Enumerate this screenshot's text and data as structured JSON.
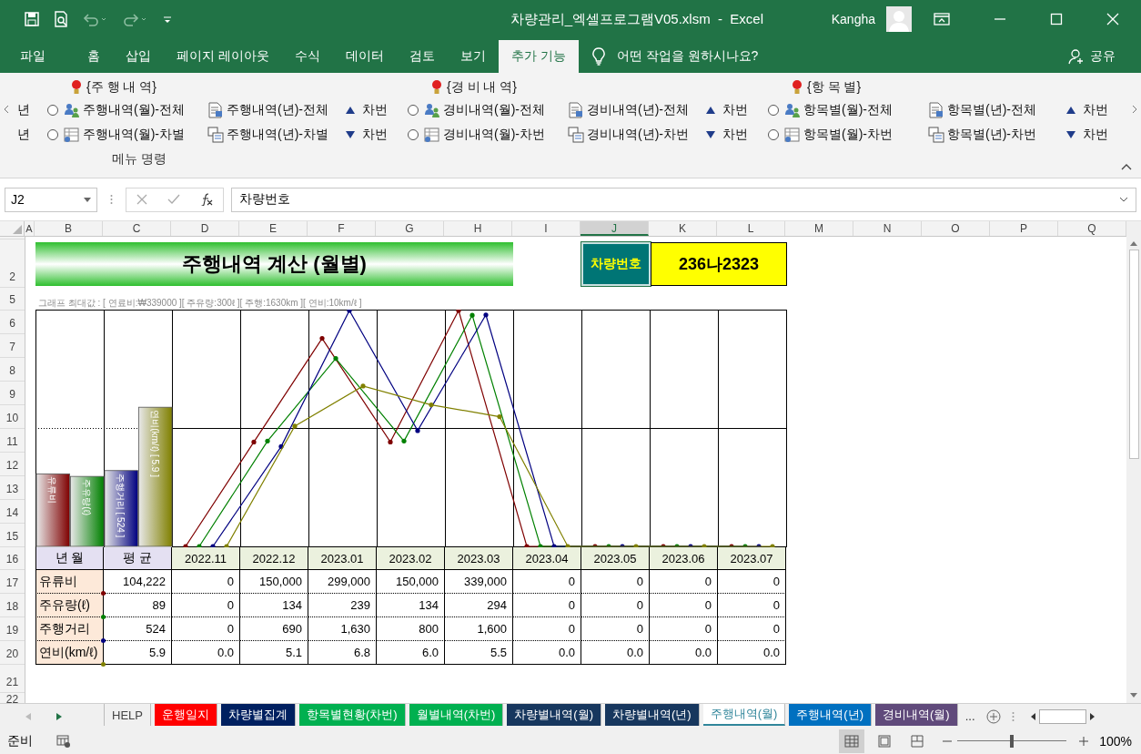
{
  "window": {
    "title": "차량관리_엑셀프로그램V05.xlsm  -  Excel",
    "user": "Kangha"
  },
  "ribbon_tabs": [
    {
      "label": "파일",
      "selected": false
    },
    {
      "label": "홈",
      "selected": false
    },
    {
      "label": "삽입",
      "selected": false
    },
    {
      "label": "페이지 레이아웃",
      "selected": false
    },
    {
      "label": "수식",
      "selected": false
    },
    {
      "label": "데이터",
      "selected": false
    },
    {
      "label": "검토",
      "selected": false
    },
    {
      "label": "보기",
      "selected": false
    },
    {
      "label": "추가 기능",
      "selected": true
    }
  ],
  "tell_me": "어떤 작업을 원하시나요?",
  "share": "공유",
  "ribbon": {
    "cut_labels": [
      "년",
      "년"
    ],
    "sections": [
      {
        "header": "{주 행 내 역}",
        "rows": [
          {
            "checked": false,
            "commands": [
              "주행내역(월)-전체",
              "주행내역(년)-전체"
            ],
            "sort": {
              "kind": "up",
              "label": "차번"
            }
          },
          {
            "checked": false,
            "commands": [
              "주행내역(월)-차별",
              "주행내역(년)-차별"
            ],
            "sort": {
              "kind": "down",
              "label": "차번"
            }
          }
        ]
      },
      {
        "header": "{경 비 내 역}",
        "rows": [
          {
            "checked": false,
            "commands": [
              "경비내역(월)-전체",
              "경비내역(년)-전체"
            ],
            "sort": {
              "kind": "up",
              "label": "차번"
            }
          },
          {
            "checked": false,
            "commands": [
              "경비내역(월)-차번",
              "경비내역(년)-차번"
            ],
            "sort": {
              "kind": "down",
              "label": "차번"
            }
          }
        ]
      },
      {
        "header": "{항 목 별}",
        "rows": [
          {
            "checked": false,
            "commands": [
              "항목별(월)-전체",
              "항목별(년)-전체"
            ],
            "sort": {
              "kind": "up",
              "label": "차번"
            }
          },
          {
            "checked": false,
            "commands": [
              "항목별(월)-차번",
              "항목별(년)-차번"
            ],
            "sort": {
              "kind": "down",
              "label": "차번"
            }
          }
        ]
      }
    ],
    "group_label": "메뉴 명령"
  },
  "formula_bar": {
    "name_box": "J2",
    "formula": "차량번호"
  },
  "columns": [
    {
      "label": "A",
      "selected": false
    },
    {
      "label": "B",
      "selected": false
    },
    {
      "label": "C",
      "selected": false
    },
    {
      "label": "D",
      "selected": false
    },
    {
      "label": "E",
      "selected": false
    },
    {
      "label": "F",
      "selected": false
    },
    {
      "label": "G",
      "selected": false
    },
    {
      "label": "H",
      "selected": false
    },
    {
      "label": "I",
      "selected": false
    },
    {
      "label": "J",
      "selected": true
    },
    {
      "label": "K",
      "selected": false
    },
    {
      "label": "L",
      "selected": false
    },
    {
      "label": "M",
      "selected": false
    },
    {
      "label": "N",
      "selected": false
    },
    {
      "label": "O",
      "selected": false
    },
    {
      "label": "P",
      "selected": false
    },
    {
      "label": "Q",
      "selected": false
    }
  ],
  "row_numbers": [
    "2",
    "5",
    "6",
    "7",
    "8",
    "9",
    "10",
    "11",
    "12",
    "13",
    "14",
    "15",
    "16",
    "17",
    "18",
    "19",
    "20",
    "21",
    "22"
  ],
  "sheet": {
    "title": "주행내역 계산 (월별)",
    "plate_label": "차량번호",
    "plate": "236나2323",
    "note": "그래프 최대값 : [ 연료비:₩339000 ][ 주유량:300ℓ ][ 주행:1630km ][ 연비:10km/ℓ ]",
    "bar_labels": [
      "유류비",
      "주유량(ℓ)",
      "주행거리 [ 524 ]",
      "연비(km/ℓ) [ 5.9 ]"
    ],
    "table": {
      "corner": [
        "년 월",
        "평 균"
      ],
      "months": [
        "2022.11",
        "2022.12",
        "2023.01",
        "2023.02",
        "2023.03",
        "2023.04",
        "2023.05",
        "2023.06",
        "2023.07"
      ],
      "rows": [
        {
          "label": "유류비",
          "color": "#7f0000",
          "average": "104,222",
          "values": [
            "0",
            "150,000",
            "299,000",
            "150,000",
            "339,000",
            "0",
            "0",
            "0",
            "0"
          ]
        },
        {
          "label": "주유량(ℓ)",
          "color": "#008000",
          "average": "89",
          "values": [
            "0",
            "134",
            "239",
            "134",
            "294",
            "0",
            "0",
            "0",
            "0"
          ]
        },
        {
          "label": "주행거리",
          "color": "#000080",
          "average": "524",
          "values": [
            "0",
            "690",
            "1,630",
            "800",
            "1,600",
            "0",
            "0",
            "0",
            "0"
          ]
        },
        {
          "label": "연비(km/ℓ)",
          "color": "#808000",
          "average": "5.9",
          "values": [
            "0.0",
            "5.1",
            "6.8",
            "6.0",
            "5.5",
            "0.0",
            "0.0",
            "0.0",
            "0.0"
          ]
        }
      ]
    }
  },
  "sheet_tabs": [
    {
      "label": "HELP",
      "selected": false
    },
    {
      "label": "운행일지",
      "color": "#ff0000",
      "selected": false
    },
    {
      "label": "차량별집계",
      "color": "#002060",
      "selected": false
    },
    {
      "label": "항목별현황(차번)",
      "color": "#00b050",
      "selected": false
    },
    {
      "label": "월별내역(차번)",
      "color": "#00b050",
      "selected": false
    },
    {
      "label": "차량별내역(월)",
      "color": "#17375e",
      "selected": false
    },
    {
      "label": "차량별내역(년)",
      "color": "#17375e",
      "selected": false
    },
    {
      "label": "주행내역(월)",
      "color": "#31869b",
      "selected": true
    },
    {
      "label": "주행내역(년)",
      "color": "#0070c0",
      "selected": false
    },
    {
      "label": "경비내역(월)",
      "color": "#604a7b",
      "selected": false
    }
  ],
  "more_tabs": "...",
  "status": {
    "text": "준비",
    "views": [
      {
        "kind": "normal",
        "selected": true
      },
      {
        "kind": "layout",
        "selected": false
      },
      {
        "kind": "pagebreak",
        "selected": false
      }
    ],
    "zoom_slider": {
      "level": 0.5
    },
    "zoom": "100%"
  }
}
